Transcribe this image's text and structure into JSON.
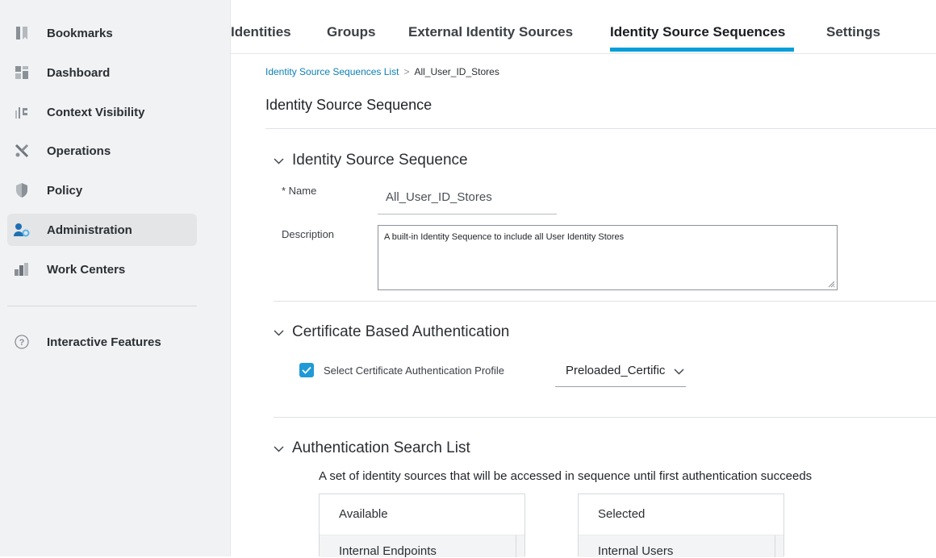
{
  "sidebar": {
    "items": [
      {
        "label": "Bookmarks",
        "icon": "bookmark-icon"
      },
      {
        "label": "Dashboard",
        "icon": "dashboard-icon"
      },
      {
        "label": "Context Visibility",
        "icon": "context-visibility-icon"
      },
      {
        "label": "Operations",
        "icon": "tools-icon"
      },
      {
        "label": "Policy",
        "icon": "shield-icon"
      },
      {
        "label": "Administration",
        "icon": "admin-user-gear-icon",
        "active": true
      },
      {
        "label": "Work Centers",
        "icon": "work-centers-icon"
      }
    ],
    "footer": {
      "label": "Interactive Features",
      "icon": "help-circle-icon"
    }
  },
  "tabs": {
    "items": [
      {
        "label": "Identities"
      },
      {
        "label": "Groups"
      },
      {
        "label": "External Identity Sources"
      },
      {
        "label": "Identity Source Sequences",
        "active": true
      },
      {
        "label": "Settings"
      }
    ],
    "accent_color": "#049fd9"
  },
  "breadcrumb": {
    "parent": "Identity Source Sequences List",
    "separator": ">",
    "current": "All_User_ID_Stores"
  },
  "page_title": "Identity Source Sequence",
  "section_identity": {
    "title": "Identity Source Sequence",
    "name_label": "* Name",
    "name_value": "All_User_ID_Stores",
    "description_label": "Description",
    "description_value": "A built-in Identity Sequence to include all User Identity Stores"
  },
  "section_certificate": {
    "title": "Certificate Based Authentication",
    "checkbox_label": "Select Certificate Authentication Profile",
    "checkbox_checked": true,
    "profile_value": "Preloaded_Certific"
  },
  "section_search": {
    "title": "Authentication Search List",
    "help_text": "A set of identity sources that will be accessed in sequence until first authentication succeeds",
    "available": {
      "header": "Available",
      "items": [
        "Internal Endpoints"
      ]
    },
    "selected": {
      "header": "Selected",
      "items": [
        "Internal Users"
      ]
    }
  }
}
